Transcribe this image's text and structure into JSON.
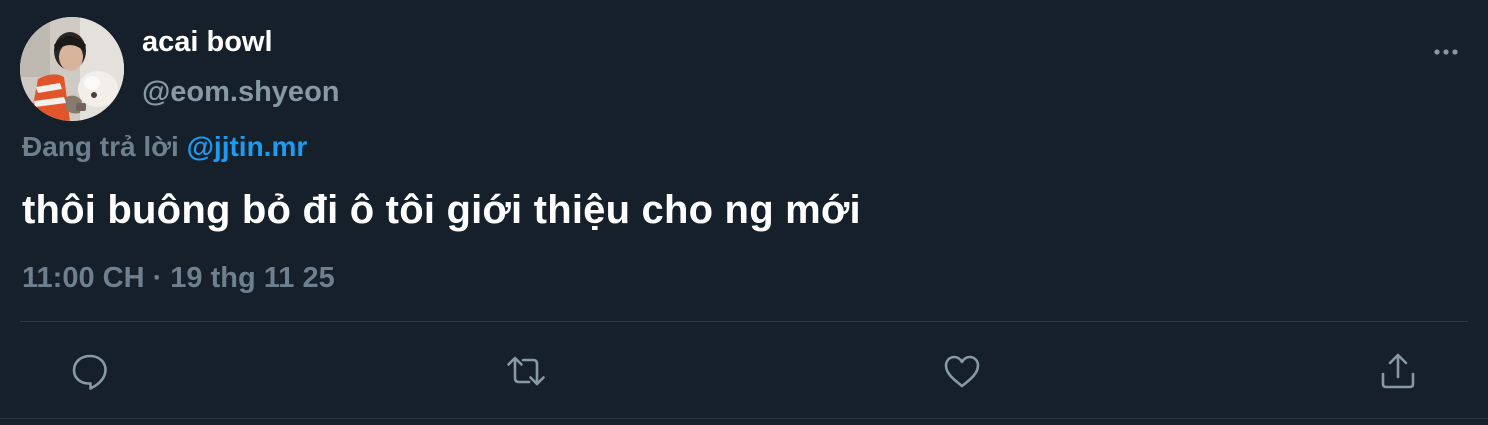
{
  "user": {
    "display_name": "acai bowl",
    "handle": "@eom.shyeon",
    "avatar_icon": "user-avatar-photo"
  },
  "reply": {
    "prefix": "Đang trả lời ",
    "mention": "@jjtin.mr"
  },
  "tweet": {
    "text": "thôi buông bỏ đi ô tôi giới thiệu cho ng mới",
    "timestamp": "11:00 CH · 19 thg 11 25"
  },
  "actions": [
    {
      "icon": "reply-icon"
    },
    {
      "icon": "retweet-icon"
    },
    {
      "icon": "like-icon"
    },
    {
      "icon": "share-icon"
    }
  ],
  "menu": {
    "icon": "more-options-icon"
  },
  "colors": {
    "background": "#15202b",
    "primary_text": "#ffffff",
    "secondary_text": "#8899a6",
    "accent": "#1d9bf0",
    "icon": "#8899a6",
    "divider": "#2f3b47"
  }
}
